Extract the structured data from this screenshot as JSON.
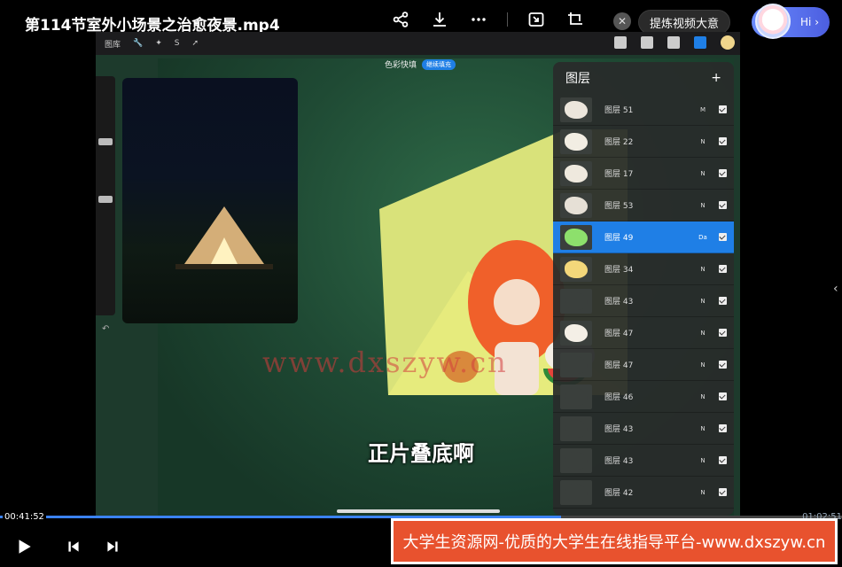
{
  "video_title": "第114节室外小场景之治愈夜景.mp4",
  "top_actions": {
    "share_icon": "share-icon",
    "download_icon": "download-icon",
    "more_icon": "more-icon",
    "pip_icon": "picture-in-picture-icon",
    "crop_icon": "crop-icon"
  },
  "summary_button": "提炼视频大意",
  "assistant_greeting": "Hi",
  "procreate": {
    "gallery_label": "图库",
    "banner_text": "色彩快填",
    "banner_chip": "继续填充",
    "layers_title": "图层",
    "layers": [
      {
        "name": "图层 51",
        "blend": "M",
        "thumb_color": "#ece6dc",
        "active": false
      },
      {
        "name": "图层 22",
        "blend": "N",
        "thumb_color": "#f2ede3",
        "active": false
      },
      {
        "name": "图层 17",
        "blend": "N",
        "thumb_color": "#efe9de",
        "active": false
      },
      {
        "name": "图层 53",
        "blend": "N",
        "thumb_color": "#e6e0d6",
        "active": false
      },
      {
        "name": "图层 49",
        "blend": "Da",
        "thumb_color": "#8de06c",
        "active": true
      },
      {
        "name": "图层 34",
        "blend": "N",
        "thumb_color": "#f3d77a",
        "active": false
      },
      {
        "name": "图层 43",
        "blend": "N",
        "thumb_color": "#3a3f3c",
        "active": false
      },
      {
        "name": "图层 47",
        "blend": "N",
        "thumb_color": "#f4efe6",
        "active": false
      },
      {
        "name": "图层 47",
        "blend": "N",
        "thumb_color": "#3a3f3c",
        "active": false
      },
      {
        "name": "图层 46",
        "blend": "N",
        "thumb_color": "#3a3f3c",
        "active": false
      },
      {
        "name": "图层 43",
        "blend": "N",
        "thumb_color": "#3a3f3c",
        "active": false
      },
      {
        "name": "图层 43",
        "blend": "N",
        "thumb_color": "#3a3f3c",
        "active": false
      },
      {
        "name": "图层 42",
        "blend": "N",
        "thumb_color": "#3a3f3c",
        "active": false
      }
    ]
  },
  "subtitle": "正片叠底啊",
  "watermark": "www.dxszyw.cn",
  "playback": {
    "current_time": "00:41:52",
    "total_time": "01:02:51",
    "progress": 0.666
  },
  "ad_banner": "大学生资源网-优质的大学生在线指导平台-www.dxszyw.cn",
  "colors": {
    "accent_blue": "#1f7fe6",
    "ad_red": "#e8522e",
    "progress_blue": "#3b82f6"
  }
}
